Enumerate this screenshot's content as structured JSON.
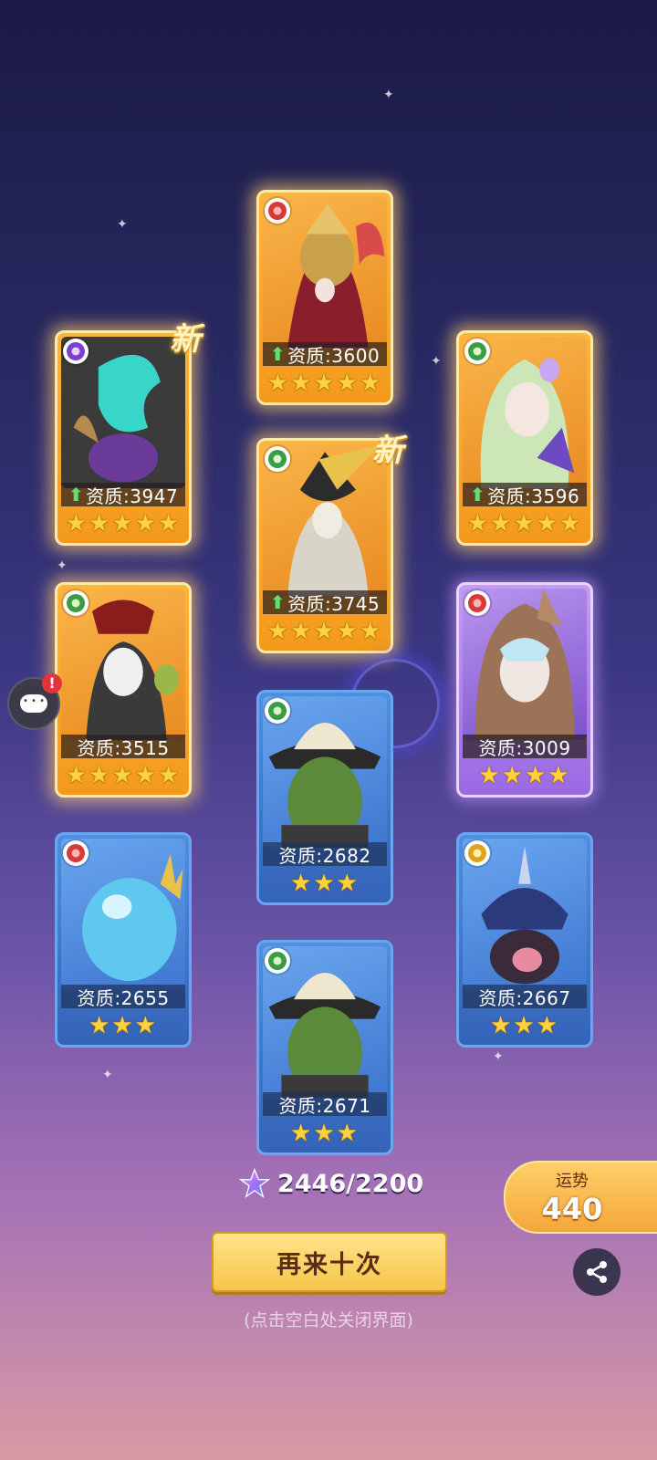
{
  "cards": [
    {
      "id": "c1",
      "rarity": "gold",
      "element": "fire",
      "quality": "资质:3600",
      "upgrade": true,
      "stars": "★★★★★",
      "is_new": false
    },
    {
      "id": "c2",
      "rarity": "gold",
      "element": "void",
      "quality": "资质:3947",
      "upgrade": true,
      "stars": "★★★★★",
      "is_new": true
    },
    {
      "id": "c3",
      "rarity": "gold",
      "element": "nature",
      "quality": "资质:3745",
      "upgrade": true,
      "stars": "★★★★★",
      "is_new": true
    },
    {
      "id": "c4",
      "rarity": "gold",
      "element": "nature",
      "quality": "资质:3596",
      "upgrade": true,
      "stars": "★★★★★",
      "is_new": false
    },
    {
      "id": "c5",
      "rarity": "gold",
      "element": "nature",
      "quality": "资质:3515",
      "upgrade": false,
      "stars": "★★★★★",
      "is_new": false
    },
    {
      "id": "c6",
      "rarity": "purple",
      "element": "fire",
      "quality": "资质:3009",
      "upgrade": false,
      "stars": "★★★★",
      "is_new": false
    },
    {
      "id": "c7",
      "rarity": "blue",
      "element": "nature",
      "quality": "资质:2682",
      "upgrade": false,
      "stars": "★★★",
      "is_new": false
    },
    {
      "id": "c8",
      "rarity": "blue",
      "element": "fire",
      "quality": "资质:2655",
      "upgrade": false,
      "stars": "★★★",
      "is_new": false
    },
    {
      "id": "c9",
      "rarity": "blue",
      "element": "earth",
      "quality": "资质:2667",
      "upgrade": false,
      "stars": "★★★",
      "is_new": false
    },
    {
      "id": "c10",
      "rarity": "blue",
      "element": "nature",
      "quality": "资质:2671",
      "upgrade": false,
      "stars": "★★★",
      "is_new": false
    }
  ],
  "new_tag": "新",
  "upgrade_arrow": "⬆",
  "chat_badge": "!",
  "cost": {
    "icon": "purple-star-gem-icon",
    "text": "2446/2200"
  },
  "again_button": "再来十次",
  "close_hint": "(点击空白处关闭界面)",
  "fortune": {
    "label": "运势",
    "value": "440"
  },
  "share_icon": "share-icon"
}
